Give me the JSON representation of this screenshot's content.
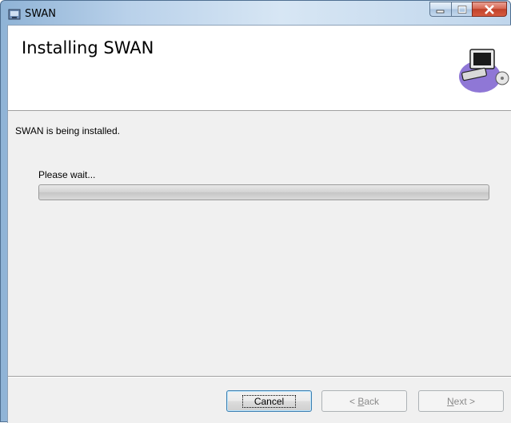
{
  "window": {
    "title": "SWAN"
  },
  "banner": {
    "title": "Installing SWAN",
    "art_icon": "computer-install-icon"
  },
  "main": {
    "status_text": "SWAN is being installed.",
    "wait_text": "Please wait...",
    "progress_fraction": 0.0
  },
  "buttons": {
    "cancel": "Cancel",
    "back_prefix": "< ",
    "back_mnemonic": "B",
    "back_rest": "ack",
    "next_mnemonic": "N",
    "next_rest": "ext >"
  },
  "colors": {
    "close_button": "#c0412a",
    "progress_fill": "#37b737"
  }
}
